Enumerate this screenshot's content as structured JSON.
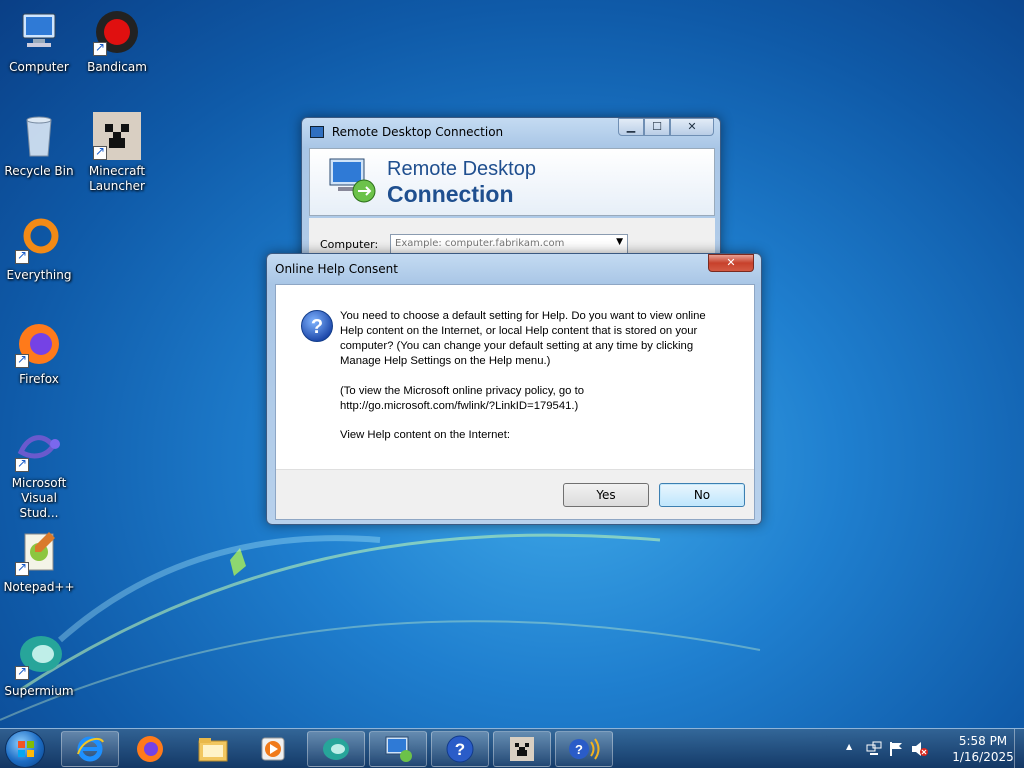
{
  "desktop_icons": [
    {
      "label": "Computer",
      "icon": "computer-icon"
    },
    {
      "label": "Bandicam",
      "icon": "bandicam-icon"
    },
    {
      "label": "Recycle Bin",
      "icon": "recycle-bin-icon"
    },
    {
      "label": "Minecraft Launcher",
      "icon": "minecraft-icon"
    },
    {
      "label": "Everything",
      "icon": "everything-icon"
    },
    {
      "label": "Firefox",
      "icon": "firefox-icon"
    },
    {
      "label": "Microsoft Visual Stud...",
      "icon": "visual-studio-icon"
    },
    {
      "label": "Notepad++",
      "icon": "notepadpp-icon"
    },
    {
      "label": "Supermium",
      "icon": "supermium-icon"
    }
  ],
  "rdc_window": {
    "title": "Remote Desktop Connection",
    "heading_line1": "Remote Desktop",
    "heading_line2": "Connection",
    "computer_label": "Computer:",
    "computer_placeholder": "Example: computer.fabrikam.com"
  },
  "dialog": {
    "title": "Online Help Consent",
    "paragraph1": "You need to choose a default setting for Help.  Do you want to view online Help content on the Internet, or local Help content that is stored on your computer?  (You can change your default setting at any time by clicking Manage Help Settings on the Help menu.)",
    "paragraph2": "(To view the Microsoft online privacy policy, go to http://go.microsoft.com/fwlink/?LinkID=179541.)",
    "paragraph3": "View Help content on the Internet:",
    "yes_label": "Yes",
    "no_label": "No",
    "close_glyph": "✕"
  },
  "window_buttons": {
    "minimize": "▁",
    "maximize": "☐",
    "close": "✕"
  },
  "taskbar": {
    "items": [
      "start-orb",
      "internet-explorer-icon",
      "firefox-icon",
      "file-explorer-icon",
      "media-player-icon",
      "supermium-icon",
      "remote-desktop-icon",
      "help-icon",
      "minecraft-icon",
      "help-sound-icon"
    ]
  },
  "tray": {
    "time": "5:58 PM",
    "date": "1/16/2025",
    "overflow_glyph": "▲"
  },
  "colors": {
    "accent": "#1f5ea8",
    "dialog_button_border": "#3c7fb1"
  }
}
